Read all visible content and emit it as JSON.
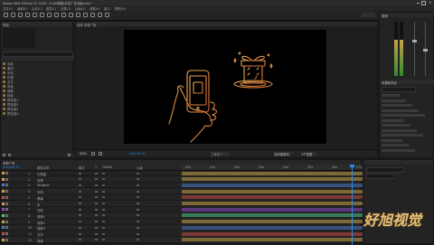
{
  "app": {
    "title": "Adobe After Effects CC 2018 - E:\\AE教程\\手机广告动画.aep *",
    "menu": [
      "文件(F)",
      "编辑(E)",
      "合成(C)",
      "图层(L)",
      "效果(T)",
      "动画(A)",
      "视图(V)",
      "窗口",
      "帮助(H)"
    ]
  },
  "project_panel": {
    "tab": "项目",
    "search_placeholder": "",
    "items": [
      "合成",
      "素材",
      "手机",
      "礼物",
      "文字",
      "背景",
      "音频",
      "纯色",
      "预合成1",
      "预合成2",
      "预合成3",
      "预合成4"
    ]
  },
  "viewer": {
    "tab": "合成 手机广告",
    "zoom": "50%",
    "quality": "二分之一",
    "camera": "活动摄像机",
    "view": "1个视图"
  },
  "effects_panel": {
    "tab": "效果和预设",
    "audio_tab": "音频"
  },
  "timeline": {
    "tab": "手机广告",
    "timecode": "0:00:05:12",
    "columns": [
      "图层名称",
      "模式",
      "T",
      "TrkMat",
      "父级"
    ],
    "layers": [
      {
        "num": "1",
        "name": "礼物盒",
        "color": "#c9a24a"
      },
      {
        "num": "2",
        "name": "丝带",
        "color": "#c9a24a"
      },
      {
        "num": "3",
        "name": "Tangent",
        "color": "#4a7ac9"
      },
      {
        "num": "4",
        "name": "手机",
        "color": "#c9a24a"
      },
      {
        "num": "5",
        "name": "屏幕",
        "color": "#c94a4a"
      },
      {
        "num": "6",
        "name": "手",
        "color": "#c9a24a"
      },
      {
        "num": "7",
        "name": "光效",
        "color": "#8a4ac9"
      },
      {
        "num": "8",
        "name": "线条1",
        "color": "#4ac98a"
      },
      {
        "num": "9",
        "name": "线条2",
        "color": "#c9a24a"
      },
      {
        "num": "10",
        "name": "线条3",
        "color": "#4a7ac9"
      },
      {
        "num": "11",
        "name": "文字",
        "color": "#c94a4a"
      },
      {
        "num": "12",
        "name": "背景",
        "color": "#c9a24a"
      }
    ],
    "ruler_labels": [
      "00s",
      "01s",
      "02s",
      "03s",
      "04s",
      "05s",
      "06s",
      "07s"
    ]
  },
  "watermark": "好旭视觉",
  "colors": {
    "accent": "#2d8ceb",
    "gold": "#e8a94a",
    "canvas": "#000000"
  }
}
